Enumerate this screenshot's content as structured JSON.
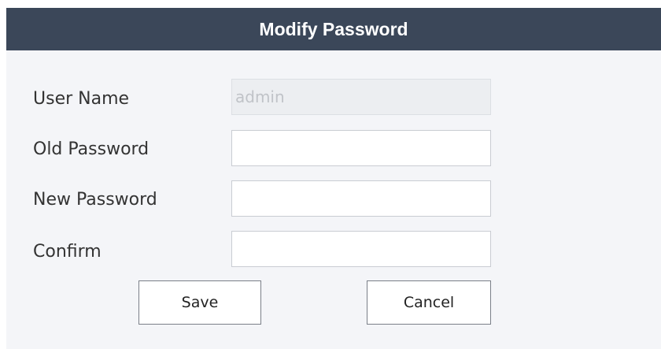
{
  "dialog": {
    "title": "Modify Password"
  },
  "form": {
    "user_name": {
      "label": "User Name",
      "value": "admin"
    },
    "old_password": {
      "label": "Old Password",
      "value": ""
    },
    "new_password": {
      "label": "New Password",
      "value": ""
    },
    "confirm": {
      "label": "Confirm",
      "value": ""
    }
  },
  "buttons": {
    "save_label": "Save",
    "cancel_label": "Cancel"
  },
  "colors": {
    "titlebar_bg": "#3b4759",
    "dialog_bg": "#f4f5f8"
  }
}
